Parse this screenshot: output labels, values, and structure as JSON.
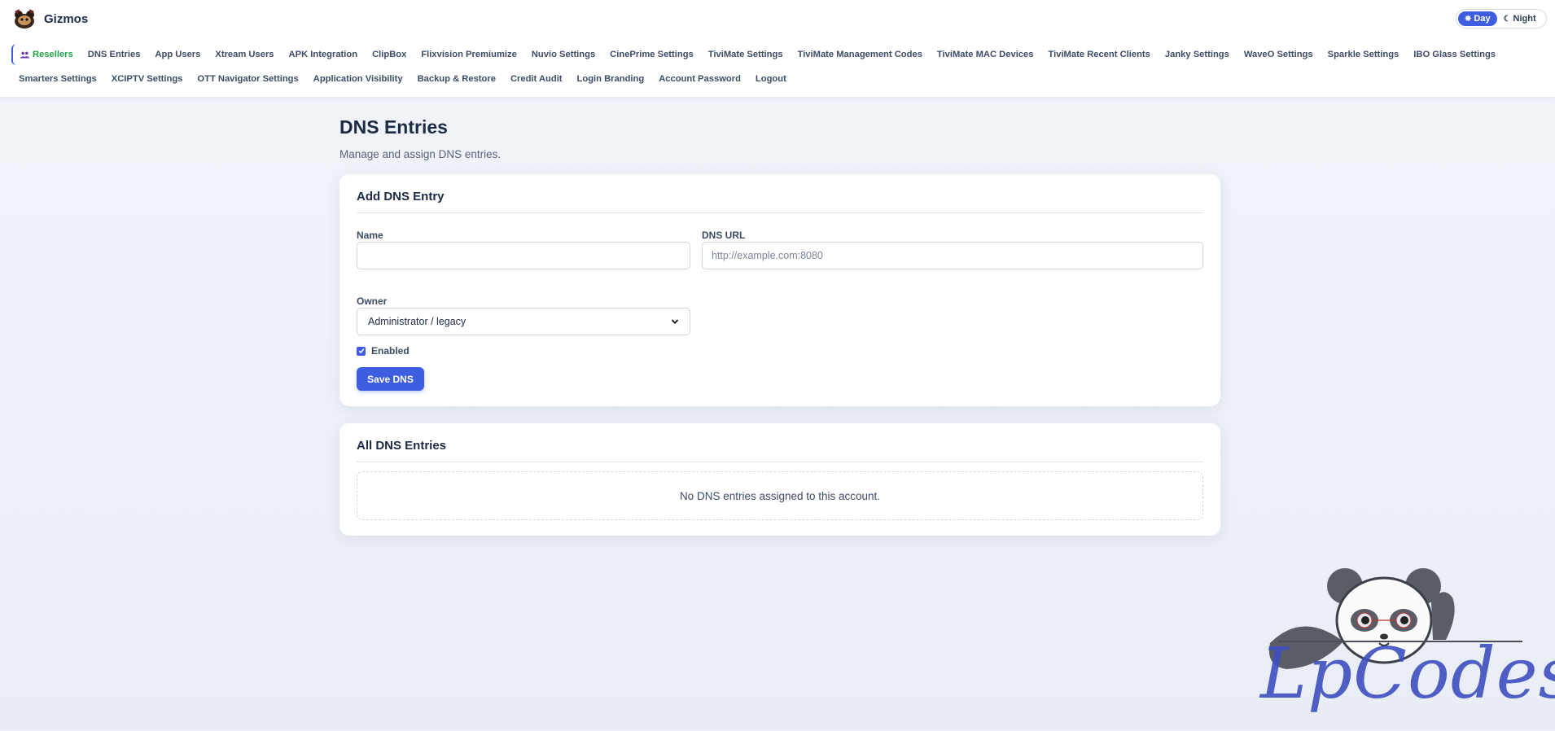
{
  "header": {
    "brand_name": "Gizmos",
    "theme": {
      "day_label": "Day",
      "night_label": "Night",
      "active": "day"
    }
  },
  "nav": {
    "row1": [
      {
        "label": "Resellers",
        "active": true
      },
      {
        "label": "DNS Entries"
      },
      {
        "label": "App Users"
      },
      {
        "label": "Xtream Users"
      },
      {
        "label": "APK Integration"
      },
      {
        "label": "ClipBox"
      },
      {
        "label": "Flixvision Premiumize"
      },
      {
        "label": "Nuvio Settings"
      },
      {
        "label": "CinePrime Settings"
      },
      {
        "label": "TiviMate Settings"
      },
      {
        "label": "TiviMate Management Codes"
      },
      {
        "label": "TiviMate MAC Devices"
      },
      {
        "label": "TiviMate Recent Clients"
      },
      {
        "label": "Janky Settings"
      },
      {
        "label": "WaveO Settings"
      },
      {
        "label": "Sparkle Settings"
      },
      {
        "label": "IBO Glass Settings"
      }
    ],
    "row2": [
      {
        "label": "Smarters Settings"
      },
      {
        "label": "XCIPTV Settings"
      },
      {
        "label": "OTT Navigator Settings"
      },
      {
        "label": "Application Visibility"
      },
      {
        "label": "Backup & Restore"
      },
      {
        "label": "Credit Audit"
      },
      {
        "label": "Login Branding"
      },
      {
        "label": "Account Password"
      },
      {
        "label": "Logout"
      }
    ]
  },
  "page": {
    "title": "DNS Entries",
    "subtitle": "Manage and assign DNS entries."
  },
  "add_form": {
    "title": "Add DNS Entry",
    "name_label": "Name",
    "name_value": "",
    "dns_url_label": "DNS URL",
    "dns_url_placeholder": "http://example.com:8080",
    "owner_label": "Owner",
    "owner_selected": "Administrator / legacy",
    "enabled_label": "Enabled",
    "enabled_checked": true,
    "save_label": "Save DNS"
  },
  "list": {
    "title": "All DNS Entries",
    "empty_message": "No DNS entries assigned to this account."
  },
  "watermark": {
    "text": "LpCodes"
  },
  "colors": {
    "accent": "#3f5de0",
    "active_nav": "#22a34a",
    "text": "#1c2a45"
  }
}
